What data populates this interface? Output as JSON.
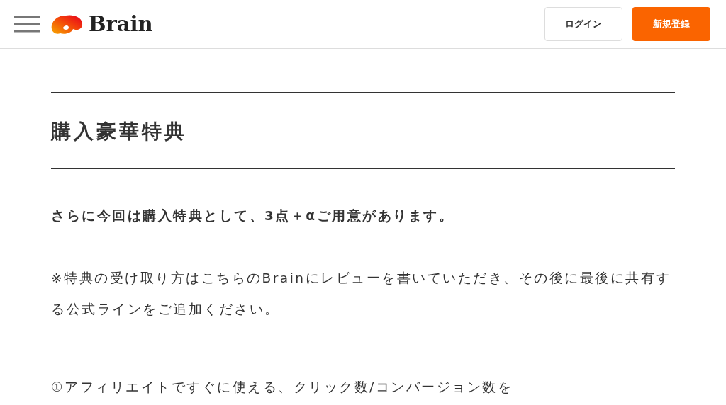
{
  "header": {
    "logo": "Brain",
    "buttons": [
      {
        "kind": "outline",
        "label": "ログイン"
      },
      {
        "kind": "primary",
        "label": "新規登録"
      }
    ]
  },
  "article": {
    "heading": "購入豪華特典",
    "paragraphs": [
      {
        "kind": "bold",
        "text": "さらに今回は購入特典として、3点＋αご用意があります。"
      },
      {
        "kind": "plain",
        "text": "※特典の受け取り方はこちらのBrainにレビューを書いていただき、その後に最後に共有する公式ラインをご追加ください。"
      },
      {
        "kind": "plain",
        "text": "①アフィリエイトですぐに使える、クリック数/コンバージョン数を"
      }
    ]
  }
}
